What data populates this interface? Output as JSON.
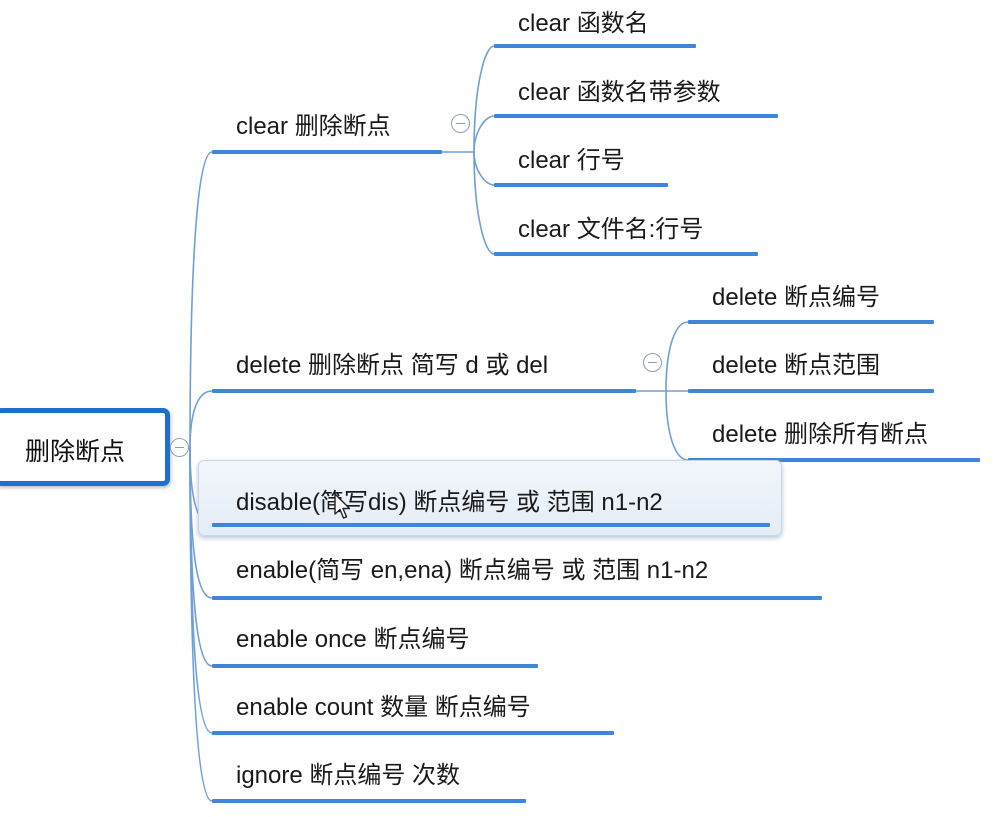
{
  "root": {
    "label": "删除断点"
  },
  "branches": [
    {
      "label": "clear 删除断点",
      "children": [
        "clear 函数名",
        "clear 函数名带参数",
        "clear 行号",
        "clear 文件名:行号"
      ]
    },
    {
      "label": "delete 删除断点 简写 d 或 del",
      "children": [
        "delete 断点编号",
        "delete 断点范围",
        "delete 删除所有断点"
      ]
    },
    {
      "label": "disable(简写dis) 断点编号 或 范围 n1-n2",
      "state": "selected"
    },
    {
      "label": "enable(简写 en,ena) 断点编号 或 范围 n1-n2"
    },
    {
      "label": "enable once 断点编号"
    },
    {
      "label": "enable count 数量 断点编号"
    },
    {
      "label": "ignore 断点编号 次数"
    }
  ],
  "colors": {
    "branch_line": "#3f86d8",
    "root_border": "#1f6fcf",
    "connector": "#6f9fd8"
  },
  "icons": {
    "collapse": "collapse-minus-icon",
    "cursor": "mouse-cursor-icon"
  }
}
